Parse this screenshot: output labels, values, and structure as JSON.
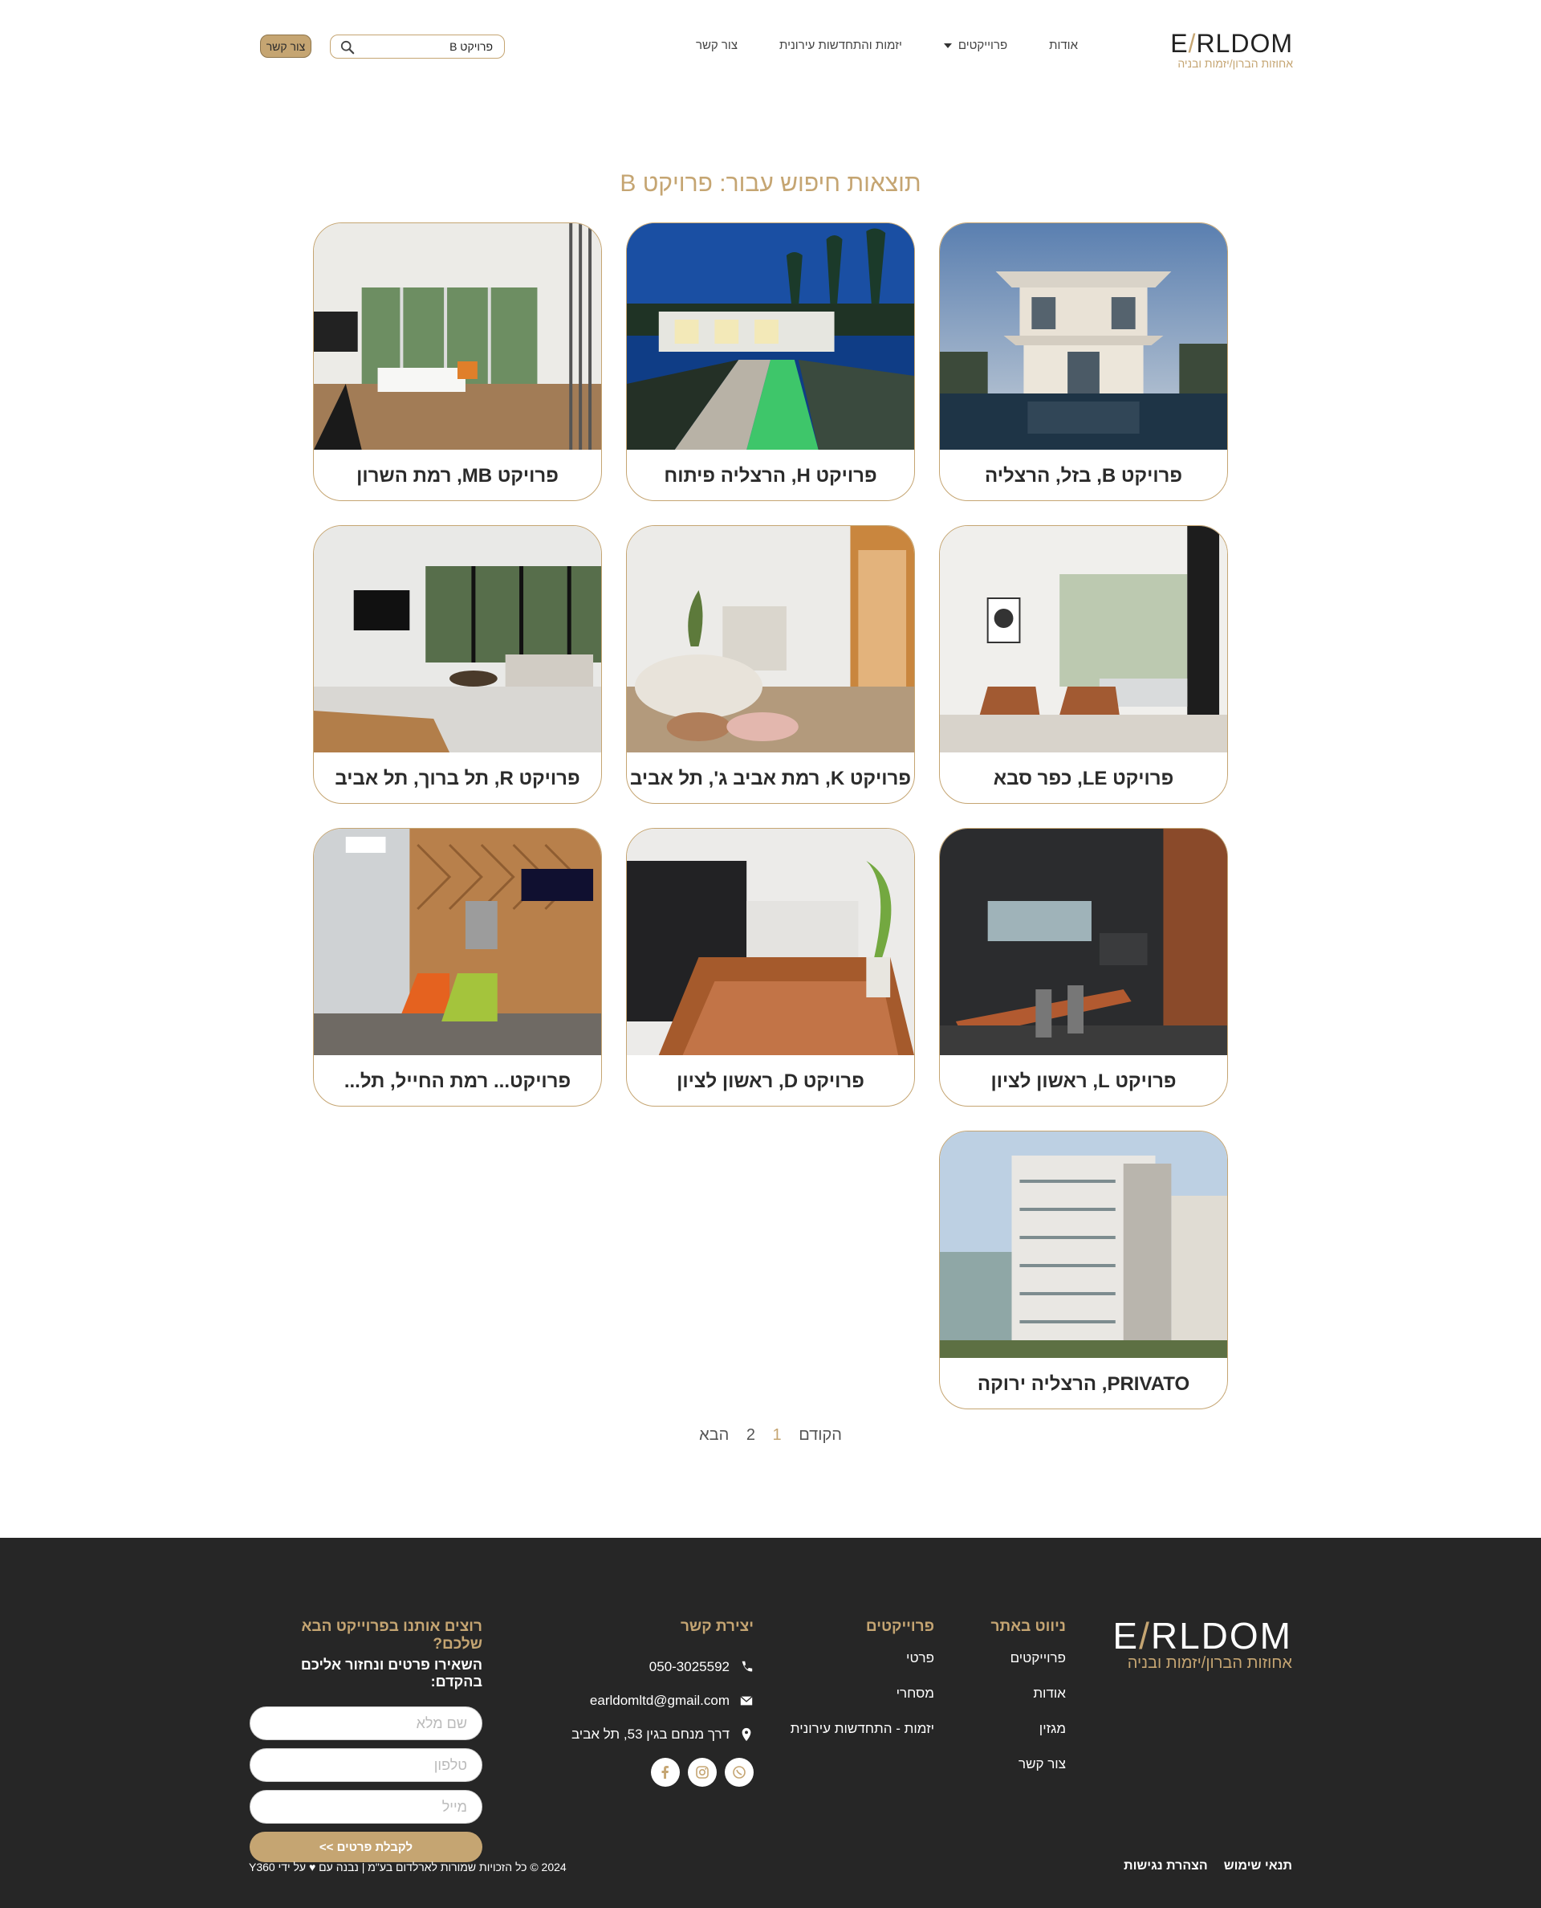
{
  "header": {
    "logo_word_left": "E",
    "logo_word_right": "RLDOM",
    "logo_sub": "אחוזות הברון/יזמות ובניה",
    "nav": [
      {
        "label": "אודות"
      },
      {
        "label": "פרוייקטים",
        "has_dropdown": true
      },
      {
        "label": "יזמות והתחדשות עירונית"
      },
      {
        "label": "צור קשר"
      }
    ],
    "search_value": "פרויקט B",
    "contact_button": "צור קשר"
  },
  "results_title": "תוצאות חיפוש עבור: פרויקט B",
  "cards": [
    {
      "caption": "פרויקט B, בזל, הרצליה"
    },
    {
      "caption": "פרויקט H, הרצליה פיתוח"
    },
    {
      "caption": "פרויקט MB, רמת השרון"
    },
    {
      "caption": "פרויקט LE, כפר סבא"
    },
    {
      "caption": "פרויקט K, רמת אביב ג', תל אביב"
    },
    {
      "caption": "פרויקט R, תל ברוך, תל אביב"
    },
    {
      "caption": "פרויקט L, ראשון לציון"
    },
    {
      "caption": "פרויקט D, ראשון לציון"
    },
    {
      "caption": "פרויקט...      רמת החייל, תל..."
    },
    {
      "caption": "PRIVATO, הרצליה ירוקה"
    }
  ],
  "pagination": {
    "prev": "הקודם",
    "current": "1",
    "page2": "2",
    "next": "הבא"
  },
  "footer": {
    "logo_word_left": "E",
    "logo_word_right": "RLDOM",
    "logo_sub": "אחוזות הברון/יזמות ובניה",
    "nav_title": "ניווט באתר",
    "nav_links": [
      "פרוייקטים",
      "אודות",
      "מגזין",
      "צור קשר"
    ],
    "projects_title": "פרוייקטים",
    "projects_links": [
      "פרטי",
      "מסחרי",
      "יזמות - התחדשות עירונית"
    ],
    "contact_title": "יצירת קשר",
    "phone": "050-3025592",
    "email": "earldomltd@gmail.com",
    "address": "דרך מנחם בגין 53, תל אביב",
    "form_title": "רוצים אותנו בפרוייקט הבא שלכם?",
    "form_sub": "השאירו פרטים ונחזור אליכם בהקדם:",
    "field_name": "שם מלא",
    "field_phone": "טלפון",
    "field_email": "מייל",
    "submit": "לקבלת פרטים >>",
    "bottom_links": [
      "תנאי שימוש",
      "הצהרת נגישות"
    ],
    "copyright": "2024 © כל הזכויות שמורות לארלדום בע\"מ | נבנה עם ♥ על ידי Y360"
  },
  "colors": {
    "accent": "#c5a572",
    "footer_bg": "#262626"
  }
}
